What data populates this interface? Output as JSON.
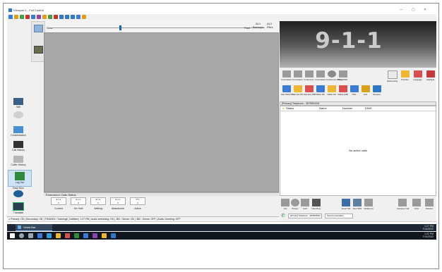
{
  "window": {
    "title": "Viewport 1 - Full Control",
    "min": "—",
    "max": "▢",
    "close": "✕"
  },
  "timebar": {
    "left_label": "Slow",
    "right_label": "Fast",
    "top_right_1": "AL1",
    "top_right_2": "AL1",
    "sub_right_1": "Backups",
    "sub_right_2": "Files"
  },
  "sidebar": [
    {
      "label": "Wifi"
    },
    {
      "label": ""
    },
    {
      "label": "Concentration"
    },
    {
      "label": "Call History"
    },
    {
      "label": "Caller History"
    },
    {
      "label": "Log Out"
    },
    {
      "label": "Easy Mon"
    },
    {
      "label": "Translate"
    }
  ],
  "logo_text": "9-1-1",
  "top_icons": [
    {
      "label": "Consultation"
    },
    {
      "label": "Consulation"
    },
    {
      "label": "Conference"
    },
    {
      "label": "Consultation"
    },
    {
      "label": "Conference Bridges"
    },
    {
      "label": "TTY / TDD"
    }
  ],
  "top_icons_right": [
    {
      "label": "Rebounding"
    },
    {
      "label": "Prioritize"
    },
    {
      "label": "Language"
    },
    {
      "label": "LifeFlight"
    }
  ],
  "speed_dials": [
    {
      "label": "Dial SWIS PD"
    },
    {
      "label": "Dial SHI PD"
    },
    {
      "label": "Dial SHI AMB"
    },
    {
      "label": "VDEO PD"
    },
    {
      "label": "VDEO FD"
    },
    {
      "label": "VDEO AMB"
    },
    {
      "label": "PSD"
    },
    {
      "label": "ALS"
    },
    {
      "label": "Wireless"
    }
  ],
  "call_panel": {
    "title": "[Primary] Telephone - 2875594331",
    "columns": [
      "Status",
      "Name",
      "Number",
      "DNIS"
    ],
    "empty_text": "No active calls"
  },
  "bottom_buttons": [
    {
      "label": "Join"
    },
    {
      "label": "Privacy"
    },
    {
      "label": "Hold"
    },
    {
      "label": "Mark Busy"
    },
    {
      "label": "Smart Tab"
    },
    {
      "label": "New SMS"
    },
    {
      "label": "Redial List"
    },
    {
      "label": "Autosave Call"
    },
    {
      "label": "Hold"
    },
    {
      "label": "Release"
    }
  ],
  "line_info": "[Primary] Telephone - 2875594331",
  "line_extra": "Send Conversation",
  "emergency": {
    "title": "Emergency Calls Status",
    "boxes": [
      "9-1-1",
      "9-1-1",
      "9-1-1",
      "9-1-1",
      "TTY"
    ],
    "box_values": [
      "0",
      "0",
      "0",
      "0",
      "0"
    ],
    "labels": [
      "Current",
      "On Hold",
      "Waiting",
      "Abandoned",
      "Active"
    ]
  },
  "status_bar": "Primary: OK  |  Secondary: OK  |  TRA9001 / Training#_Caltfleet  |  1:27 PM  |  Audio streaming: OK  |  JB1 : Sense: OK  |  JB2 : Sense: OFF  |  Audio Greeting: OFF",
  "taskbar": {
    "app_label": "Vesta Bar",
    "time": "1:27 PM",
    "date": "7/14/2022",
    "time2": "1:22 PM",
    "date2": "7/14/2022"
  },
  "colors": {
    "accent": "#1a5fb4",
    "taskbar": "#1b2734",
    "video_bg": "#a8a8a8"
  }
}
